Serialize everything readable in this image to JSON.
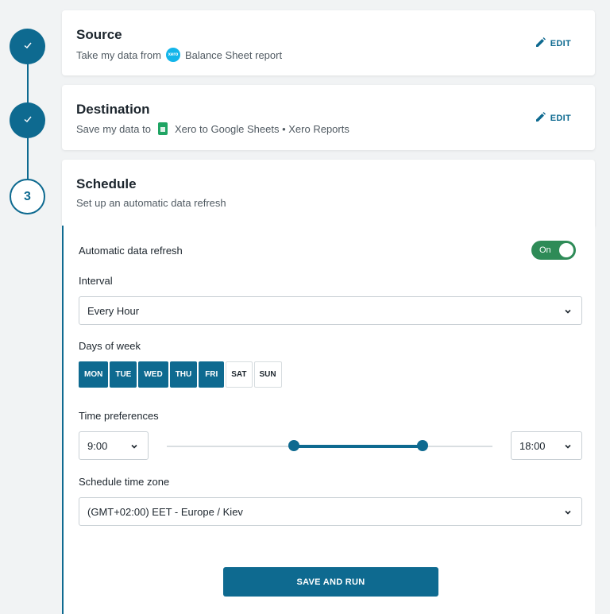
{
  "steps": [
    {
      "state": "done",
      "label": "✓"
    },
    {
      "state": "done",
      "label": "✓"
    },
    {
      "state": "active",
      "label": "3"
    }
  ],
  "source": {
    "title": "Source",
    "subtitle_prefix": "Take my data from",
    "logo_text": "xero",
    "subtitle_value": "Balance Sheet report",
    "edit_label": "EDIT"
  },
  "destination": {
    "title": "Destination",
    "subtitle_prefix": "Save my data to",
    "subtitle_value": "Xero to Google Sheets • Xero Reports",
    "edit_label": "EDIT"
  },
  "schedule": {
    "title": "Schedule",
    "subtitle": "Set up an automatic data refresh",
    "auto_refresh_label": "Automatic data refresh",
    "toggle_label": "On",
    "interval_label": "Interval",
    "interval_value": "Every Hour",
    "days_label": "Days of week",
    "days": [
      {
        "label": "MON",
        "selected": true
      },
      {
        "label": "TUE",
        "selected": true
      },
      {
        "label": "WED",
        "selected": true
      },
      {
        "label": "THU",
        "selected": true
      },
      {
        "label": "FRI",
        "selected": true
      },
      {
        "label": "SAT",
        "selected": false
      },
      {
        "label": "SUN",
        "selected": false
      }
    ],
    "time_pref_label": "Time preferences",
    "time_start": "9:00",
    "time_end": "18:00",
    "timezone_label": "Schedule time zone",
    "timezone_value": "(GMT+02:00) EET - Europe / Kiev",
    "save_label": "SAVE AND RUN"
  },
  "colors": {
    "accent": "#0e6a90",
    "toggle_on": "#2e8b57",
    "background": "#f1f3f4"
  }
}
